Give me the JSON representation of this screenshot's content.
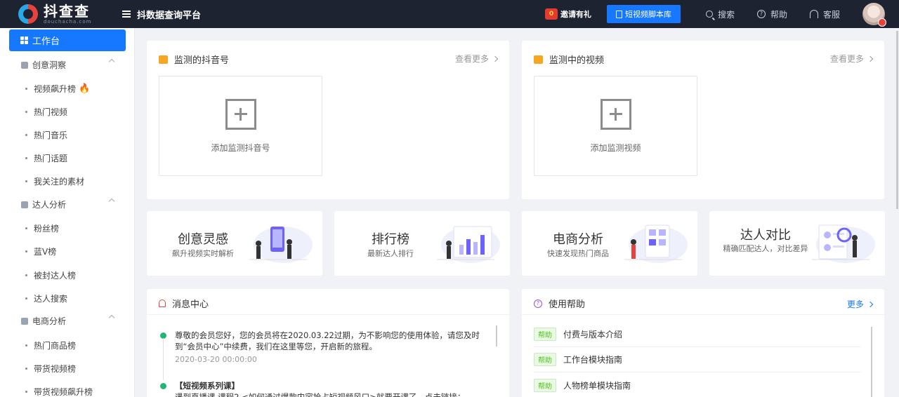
{
  "app": {
    "logo_title": "抖查查",
    "logo_sub": "douchacha.com",
    "platform_title": "抖数据查询平台"
  },
  "topbar": {
    "invite_label": "邀请有礼",
    "script_button": "短视频脚本库",
    "search": "搜索",
    "help": "帮助",
    "service": "客服"
  },
  "sidebar": {
    "active": "工作台",
    "groups": [
      {
        "label": "创意洞察",
        "items": [
          "视频飙升榜",
          "热门视频",
          "热门音乐",
          "热门话题",
          "我关注的素材"
        ]
      },
      {
        "label": "达人分析",
        "items": [
          "粉丝榜",
          "蓝V榜",
          "被封达人榜",
          "达人搜索"
        ]
      },
      {
        "label": "电商分析",
        "items": [
          "热门商品榜",
          "带货视频榜",
          "带货视频飙升榜"
        ]
      }
    ]
  },
  "monitor_account": {
    "title": "监测的抖音号",
    "more": "查看更多",
    "add_label": "添加监测抖音号"
  },
  "monitor_video": {
    "title": "监测中的视频",
    "more": "查看更多",
    "add_label": "添加监测视频"
  },
  "features": [
    {
      "title": "创意灵感",
      "sub": "飙升视频实时解析"
    },
    {
      "title": "排行榜",
      "sub": "最新达人排行"
    },
    {
      "title": "电商分析",
      "sub": "快速发现热门商品"
    },
    {
      "title": "达人对比",
      "sub": "精确匹配达人，对比差异"
    }
  ],
  "messages": {
    "title": "消息中心",
    "items": [
      {
        "text": "尊敬的会员您好，您的会员将在2020.03.22过期，为不影响您的使用体验，请您及时到“会员中心”中续费，我们在这里等您，开启新的旅程。",
        "time": "2020-03-20 00:00:00"
      },
      {
        "text": "【短视频系列课】",
        "time": ""
      }
    ],
    "second_line": "遇到直播课 课程2 <如何通过爆款内容抢占短视频风口>就要开课了，点击链接："
  },
  "help": {
    "title": "使用帮助",
    "more": "更多",
    "tag": "帮助",
    "items": [
      "付费与版本介绍",
      "工作台模块指南",
      "人物榜单模块指南"
    ]
  },
  "colors": {
    "topbar": "#1d2330",
    "primary": "#1677ff",
    "success": "#22b573",
    "accent": "#f5a623"
  }
}
